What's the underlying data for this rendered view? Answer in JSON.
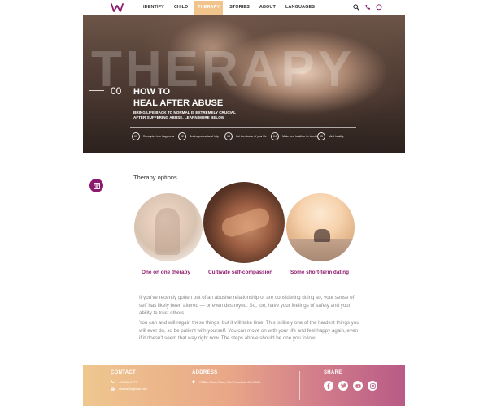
{
  "nav": {
    "logo": "W",
    "items": [
      {
        "label": "IDENTIFY",
        "active": false
      },
      {
        "label": "CHILD",
        "active": false
      },
      {
        "label": "THERAPY",
        "active": true
      },
      {
        "label": "STORIES",
        "active": false
      },
      {
        "label": "ABOUT",
        "active": false
      },
      {
        "label": "LANGUAGES",
        "active": false
      }
    ],
    "icons": [
      "search-icon",
      "phone-icon",
      "chat-icon"
    ]
  },
  "hero": {
    "background_word": "THERAPY",
    "number": "00",
    "title_line1": "HOW TO",
    "title_line2": "HEAL AFTER ABUSE",
    "subtitle": "BRING LIFE BACK TO NORMAL IS EXTREMELY CRUCIAL AFTER SUFFERING ABUSE. LEARN MORE BELOW",
    "steps": [
      {
        "num": "01",
        "text": "Recognize true happiness"
      },
      {
        "num": "02",
        "text": "Seek a professional help"
      },
      {
        "num": "03",
        "text": "Cut the abuser of your life"
      },
      {
        "num": "04",
        "text": "Make new healthier tie identity"
      },
      {
        "num": "05",
        "text": "Mind healthy"
      }
    ]
  },
  "options": {
    "badge_icon": "therapy-logo-icon",
    "title": "Therapy options",
    "items": [
      {
        "caption": "One on one therapy"
      },
      {
        "caption": "Cultivate self-compassion"
      },
      {
        "caption": "Some short-term dating"
      }
    ]
  },
  "body": {
    "para1": "If you've recently gotten out of an abusive relationship or are considering doing so, your sense of self has likely been altered — or even destroyed. So, too, have your feelings of safety and your ability to trust others.",
    "para2": "You can and will regain these things, but it will take time. This is likely one of the hardest things you will ever do, so be patient with yourself. You can move on with your life and feel happy again, even if it doesn't seem that way right now. The steps above should be one you follow."
  },
  "footer": {
    "contact_heading": "CONTACT",
    "phone": "415-858-6777",
    "email": "dhama@wglobal.com",
    "address_heading": "ADDRESS",
    "address": "79 Blue Moon Place, San Francisco, CA 94105",
    "share_heading": "SHARE",
    "share_icons": [
      "facebook-icon",
      "twitter-icon",
      "youtube-icon",
      "instagram-icon"
    ]
  },
  "colors": {
    "brand": "#8e1a6e",
    "nav_active": "#f0c48a",
    "footer_gradient_start": "#efc78e",
    "footer_gradient_end": "#b85b86",
    "body_text": "#888888"
  }
}
